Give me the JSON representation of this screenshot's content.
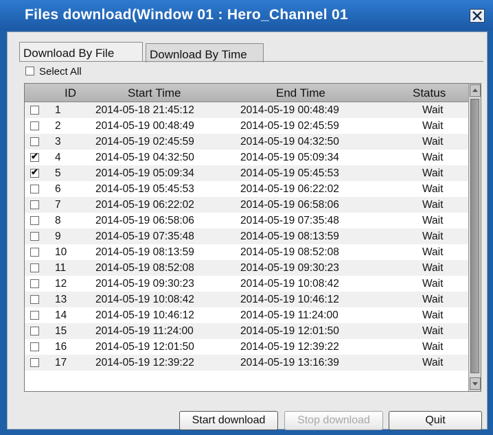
{
  "window": {
    "title": "Files download(Window 01 : Hero_Channel  01",
    "close_icon": "close-icon"
  },
  "tabs": [
    {
      "label": "Download By File",
      "active": true
    },
    {
      "label": "Download By Time",
      "active": false
    }
  ],
  "select_all": {
    "label": "Select All",
    "checked": false
  },
  "table": {
    "headers": {
      "id": "ID",
      "start": "Start Time",
      "end": "End Time",
      "status": "Status"
    },
    "rows": [
      {
        "checked": false,
        "id": "1",
        "start": "2014-05-18  21:45:12",
        "end": "2014-05-19  00:48:49",
        "status": "Wait"
      },
      {
        "checked": false,
        "id": "2",
        "start": "2014-05-19  00:48:49",
        "end": "2014-05-19  02:45:59",
        "status": "Wait"
      },
      {
        "checked": false,
        "id": "3",
        "start": "2014-05-19  02:45:59",
        "end": "2014-05-19  04:32:50",
        "status": "Wait"
      },
      {
        "checked": true,
        "id": "4",
        "start": "2014-05-19  04:32:50",
        "end": "2014-05-19  05:09:34",
        "status": "Wait"
      },
      {
        "checked": true,
        "id": "5",
        "start": "2014-05-19  05:09:34",
        "end": "2014-05-19  05:45:53",
        "status": "Wait"
      },
      {
        "checked": false,
        "id": "6",
        "start": "2014-05-19  05:45:53",
        "end": "2014-05-19  06:22:02",
        "status": "Wait"
      },
      {
        "checked": false,
        "id": "7",
        "start": "2014-05-19  06:22:02",
        "end": "2014-05-19  06:58:06",
        "status": "Wait"
      },
      {
        "checked": false,
        "id": "8",
        "start": "2014-05-19  06:58:06",
        "end": "2014-05-19  07:35:48",
        "status": "Wait"
      },
      {
        "checked": false,
        "id": "9",
        "start": "2014-05-19  07:35:48",
        "end": "2014-05-19  08:13:59",
        "status": "Wait"
      },
      {
        "checked": false,
        "id": "10",
        "start": "2014-05-19  08:13:59",
        "end": "2014-05-19  08:52:08",
        "status": "Wait"
      },
      {
        "checked": false,
        "id": "11",
        "start": "2014-05-19  08:52:08",
        "end": "2014-05-19  09:30:23",
        "status": "Wait"
      },
      {
        "checked": false,
        "id": "12",
        "start": "2014-05-19  09:30:23",
        "end": "2014-05-19  10:08:42",
        "status": "Wait"
      },
      {
        "checked": false,
        "id": "13",
        "start": "2014-05-19  10:08:42",
        "end": "2014-05-19  10:46:12",
        "status": "Wait"
      },
      {
        "checked": false,
        "id": "14",
        "start": "2014-05-19  10:46:12",
        "end": "2014-05-19  11:24:00",
        "status": "Wait"
      },
      {
        "checked": false,
        "id": "15",
        "start": "2014-05-19  11:24:00",
        "end": "2014-05-19  12:01:50",
        "status": "Wait"
      },
      {
        "checked": false,
        "id": "16",
        "start": "2014-05-19  12:01:50",
        "end": "2014-05-19  12:39:22",
        "status": "Wait"
      },
      {
        "checked": false,
        "id": "17",
        "start": "2014-05-19  12:39:22",
        "end": "2014-05-19  13:16:39",
        "status": "Wait"
      }
    ]
  },
  "buttons": {
    "start": "Start download",
    "stop": "Stop download",
    "quit": "Quit"
  },
  "colors": {
    "titlebar": "#1f5fa8",
    "client_bg": "#e9e9e9",
    "alt_row": "#f0f0f0"
  }
}
